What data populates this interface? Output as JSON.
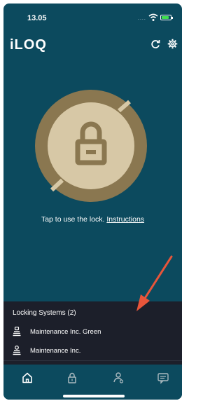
{
  "status_bar": {
    "time": "13.05",
    "signal_dots": "....",
    "battery_color": "#3fdf4f"
  },
  "header": {
    "app_title": "iLOQ"
  },
  "main": {
    "tap_text": "Tap to use the lock.",
    "instructions_link": "Instructions"
  },
  "locking_systems": {
    "title": "Locking Systems (2)",
    "items": [
      {
        "label": "Maintenance Inc. Green",
        "icon": "key-stack-icon"
      },
      {
        "label": "Maintenance Inc.",
        "icon": "key-stack-icon"
      }
    ]
  },
  "tabbar": {
    "tabs": [
      {
        "name": "home",
        "icon": "home-icon",
        "selected": true
      },
      {
        "name": "lock",
        "icon": "lock-icon",
        "selected": false
      },
      {
        "name": "people",
        "icon": "person-icon",
        "selected": false
      },
      {
        "name": "messages",
        "icon": "message-icon",
        "selected": false
      }
    ]
  },
  "colors": {
    "background": "#0c4a5e",
    "lock_ring": "#8a7750",
    "lock_inner": "#d7c8a6",
    "panel": "#1c1f2a",
    "annotation_arrow": "#e8553a"
  }
}
